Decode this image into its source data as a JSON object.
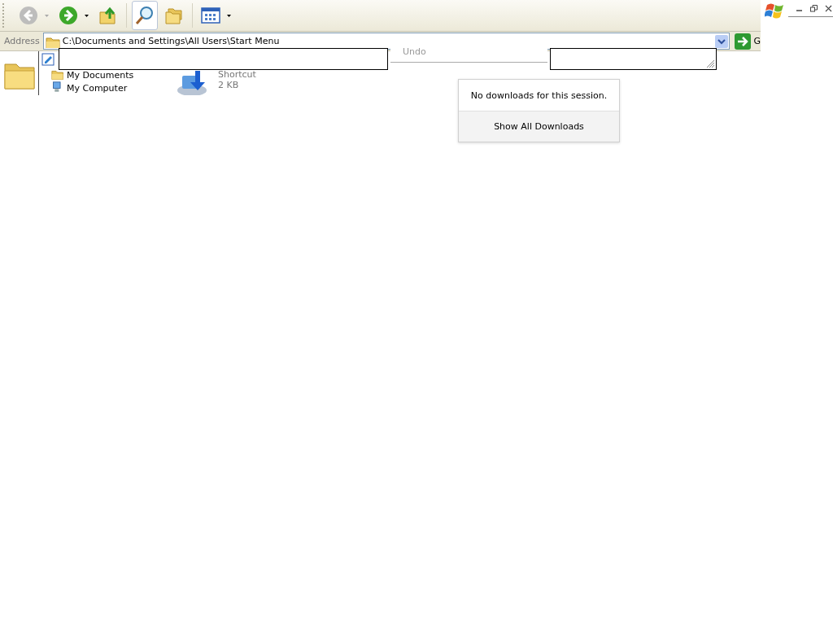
{
  "toolbar": {
    "buttons": [
      {
        "kind": "back",
        "disabled": true,
        "selected": false,
        "dropdown": true
      },
      {
        "kind": "forward",
        "disabled": false,
        "selected": false,
        "dropdown": true
      },
      {
        "kind": "up",
        "disabled": false,
        "selected": false,
        "dropdown": false
      },
      {
        "kind": "search",
        "disabled": false,
        "selected": true,
        "dropdown": false
      },
      {
        "kind": "folders",
        "disabled": false,
        "selected": false,
        "dropdown": false
      },
      {
        "kind": "views",
        "disabled": false,
        "selected": false,
        "dropdown": true
      }
    ]
  },
  "address_bar": {
    "label": "Address",
    "path": "C:\\Documents and Settings\\All Users\\Start Menu",
    "go_label": "G"
  },
  "folder_tree": {
    "items": [
      {
        "label": "My Documents",
        "kind": "documents"
      },
      {
        "label": "My Computer",
        "kind": "computer"
      }
    ]
  },
  "file_details": {
    "type": "Shortcut",
    "size": "2 KB"
  },
  "menu_fragment": {
    "item": "Undo",
    "disabled": true
  },
  "downloads_panel": {
    "message": "No downloads for this session.",
    "button": {
      "label": "Show All Downloads"
    }
  }
}
